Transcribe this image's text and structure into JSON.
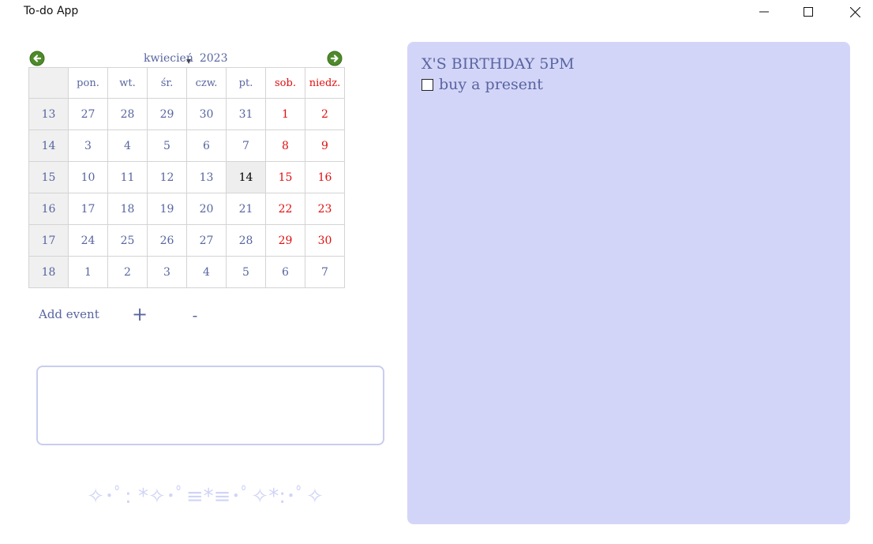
{
  "window": {
    "title": "To-do App",
    "controls": [
      "minimize-icon",
      "maximize-icon",
      "close-icon"
    ]
  },
  "calendar": {
    "month": "kwiecień",
    "year": "2023",
    "weekdays": [
      "pon.",
      "wt.",
      "śr.",
      "czw.",
      "pt.",
      "sob.",
      "niedz."
    ],
    "weeks": [
      {
        "week": "13",
        "days": [
          "27",
          "28",
          "29",
          "30",
          "31",
          "1",
          "2"
        ]
      },
      {
        "week": "14",
        "days": [
          "3",
          "4",
          "5",
          "6",
          "7",
          "8",
          "9"
        ]
      },
      {
        "week": "15",
        "days": [
          "10",
          "11",
          "12",
          "13",
          "14",
          "15",
          "16"
        ]
      },
      {
        "week": "16",
        "days": [
          "17",
          "18",
          "19",
          "20",
          "21",
          "22",
          "23"
        ]
      },
      {
        "week": "17",
        "days": [
          "24",
          "25",
          "26",
          "27",
          "28",
          "29",
          "30"
        ]
      },
      {
        "week": "18",
        "days": [
          "1",
          "2",
          "3",
          "4",
          "5",
          "6",
          "7"
        ]
      }
    ],
    "selected_day": "14",
    "colors": {
      "text": "#5865a0",
      "weekend": "#e01010",
      "nav_arrow": "#4e8a2a"
    }
  },
  "events": {
    "add_label": "Add event",
    "add_button": "+",
    "remove_button": "-",
    "input_value": "",
    "decoration": "✧･ﾟ: *✧･ﾟ≡*≡･ﾟ✧*:･ﾟ✧"
  },
  "notes": {
    "event_title": "X'S BIRTHDAY 5PM",
    "tasks": [
      {
        "label": "buy a present",
        "checked": false
      }
    ],
    "panel_color": "#d3d5f8"
  }
}
